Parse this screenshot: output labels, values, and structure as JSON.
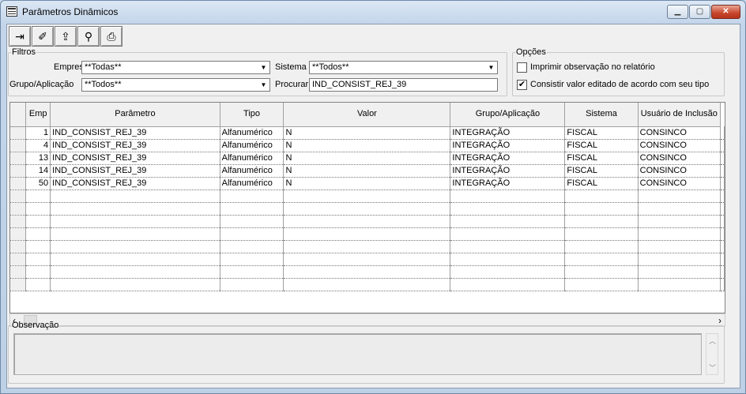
{
  "window": {
    "title": "Parâmetros Dinâmicos"
  },
  "toolbar": {
    "buttons": [
      {
        "name": "exit-icon",
        "glyph": "⇥"
      },
      {
        "name": "eraser-icon",
        "glyph": "✐"
      },
      {
        "name": "export-icon",
        "glyph": "⇪"
      },
      {
        "name": "binoculars-icon",
        "glyph": "⚲"
      },
      {
        "name": "print-icon",
        "glyph": "⎙"
      }
    ]
  },
  "filtros": {
    "legend": "Filtros",
    "empresa_label": "Empresa",
    "empresa_value": "**Todas**",
    "grupo_label": "Grupo/Aplicação",
    "grupo_value": "**Todos**",
    "sistema_label": "Sistema",
    "sistema_value": "**Todos**",
    "procurar_label": "Procurar",
    "procurar_value": "IND_CONSIST_REJ_39"
  },
  "opcoes": {
    "legend": "Opções",
    "imprimir_label": "Imprimir observação no relatório",
    "imprimir_checked": false,
    "consistir_label": "Consistir valor editado de acordo com seu tipo",
    "consistir_checked": true,
    "check_mark": "✔"
  },
  "grid": {
    "columns": [
      "Emp",
      "Parâmetro",
      "Tipo",
      "Valor",
      "Grupo/Aplicação",
      "Sistema",
      "Usuário de Inclusão"
    ],
    "rows": [
      [
        "1",
        "IND_CONSIST_REJ_39",
        "Alfanumérico",
        "N",
        "INTEGRAÇÃO",
        "FISCAL",
        "CONSINCO"
      ],
      [
        "4",
        "IND_CONSIST_REJ_39",
        "Alfanumérico",
        "N",
        "INTEGRAÇÃO",
        "FISCAL",
        "CONSINCO"
      ],
      [
        "13",
        "IND_CONSIST_REJ_39",
        "Alfanumérico",
        "N",
        "INTEGRAÇÃO",
        "FISCAL",
        "CONSINCO"
      ],
      [
        "14",
        "IND_CONSIST_REJ_39",
        "Alfanumérico",
        "N",
        "INTEGRAÇÃO",
        "FISCAL",
        "CONSINCO"
      ],
      [
        "50",
        "IND_CONSIST_REJ_39",
        "Alfanumérico",
        "N",
        "INTEGRAÇÃO",
        "FISCAL",
        "CONSINCO"
      ]
    ],
    "empty_rows": 8
  },
  "observacao": {
    "legend": "Observação"
  }
}
